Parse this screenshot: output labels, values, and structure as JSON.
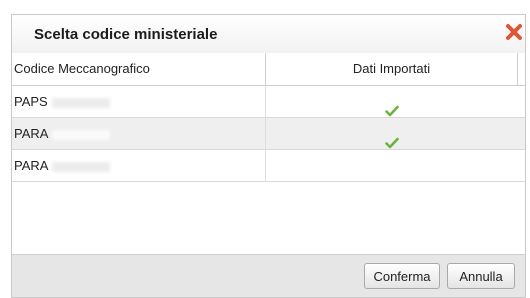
{
  "dialog": {
    "title": "Scelta codice ministeriale",
    "close_icon": "close-x-icon",
    "accent_color": "#e05535"
  },
  "table": {
    "headers": [
      "Codice Meccanografico",
      "Dati Importati"
    ],
    "rows": [
      {
        "code": "PAPS",
        "imported": true
      },
      {
        "code": "PARA",
        "imported": true
      },
      {
        "code": "PARA",
        "imported": false
      }
    ],
    "check_icon": "checkmark-icon",
    "check_color": "#6db33f"
  },
  "footer": {
    "confirm_label": "Conferma",
    "cancel_label": "Annulla"
  }
}
